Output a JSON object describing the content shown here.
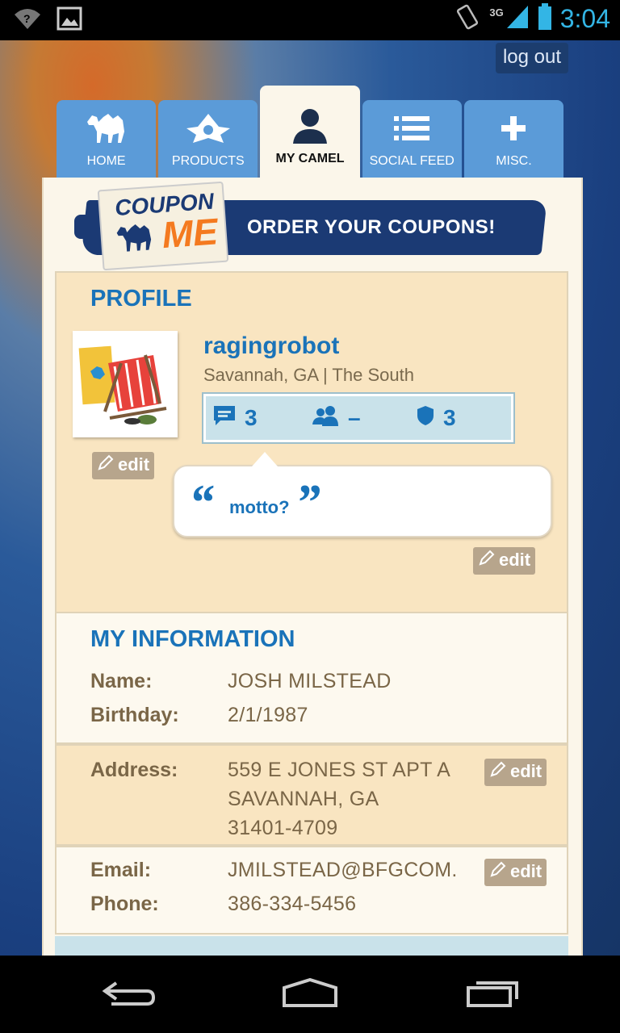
{
  "status_bar": {
    "time": "3:04",
    "network": "3G"
  },
  "app": {
    "logout": "log out"
  },
  "tabs": [
    {
      "label": "HOME",
      "icon": "camel-icon"
    },
    {
      "label": "PRODUCTS",
      "icon": "ornament-icon"
    },
    {
      "label": "MY CAMEL",
      "icon": "person-icon"
    },
    {
      "label": "SOCIAL FEED",
      "icon": "list-icon"
    },
    {
      "label": "MISC.",
      "icon": "plus-icon"
    }
  ],
  "banner": {
    "coupon": "COUPON",
    "me": "ME",
    "cta": "ORDER YOUR COUPONS!"
  },
  "profile": {
    "title": "PROFILE",
    "username": "ragingrobot",
    "location": "Savannah, GA | The South",
    "stats": {
      "messages": "3",
      "friends": "–",
      "badges": "3"
    },
    "motto": "motto?",
    "edit_label": "edit"
  },
  "info": {
    "title": "MY INFORMATION",
    "name_label": "Name:",
    "name": "JOSH MILSTEAD",
    "birthday_label": "Birthday:",
    "birthday": "2/1/1987",
    "address_label": "Address:",
    "address_line1": "559 E JONES ST APT A",
    "address_line2": "SAVANNAH, GA",
    "address_line3": "31401-4709",
    "email_label": "Email:",
    "email": "JMILSTEAD@BFGCOM.",
    "phone_label": "Phone:",
    "phone": "386-334-5456",
    "edit_label": "edit"
  },
  "colors": {
    "accent": "#1a73b9",
    "tab": "#5b9bd8",
    "status": "#33b5e5"
  }
}
